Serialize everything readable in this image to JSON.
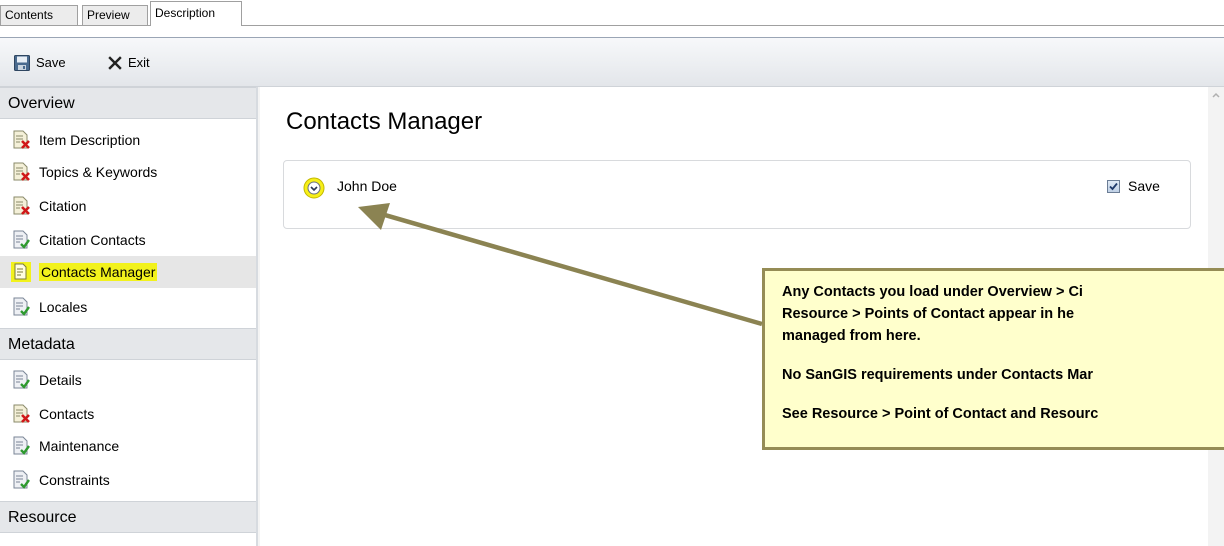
{
  "tabs": [
    {
      "label": "Contents",
      "active": false
    },
    {
      "label": "Preview",
      "active": false
    },
    {
      "label": "Description",
      "active": true
    }
  ],
  "toolbar": {
    "save_label": "Save",
    "exit_label": "Exit"
  },
  "sidebar": {
    "sections": [
      {
        "title": "Overview"
      },
      {
        "title": "Metadata"
      },
      {
        "title": "Resource"
      }
    ],
    "overview_items": [
      {
        "label": "Item Description",
        "status": "error"
      },
      {
        "label": "Topics & Keywords",
        "status": "error"
      },
      {
        "label": "Citation",
        "status": "error"
      },
      {
        "label": "Citation Contacts",
        "status": "ok"
      },
      {
        "label": "Contacts Manager",
        "status": "ok",
        "selected": true,
        "highlight_color": "#f2f21c"
      },
      {
        "label": "Locales",
        "status": "ok"
      }
    ],
    "metadata_items": [
      {
        "label": "Details",
        "status": "ok"
      },
      {
        "label": "Contacts",
        "status": "error"
      },
      {
        "label": "Maintenance",
        "status": "ok"
      },
      {
        "label": "Constraints",
        "status": "ok"
      }
    ]
  },
  "main": {
    "title": "Contacts Manager",
    "contacts": [
      {
        "name": "John Doe",
        "save_label": "Save",
        "save_checked": true
      }
    ]
  },
  "callout": {
    "lines": [
      "Any Contacts you load under Overview > Ci",
      "Resource > Points of Contact appear in he",
      "managed from here.",
      "No SanGIS requirements under Contacts Mar",
      "See Resource > Point of Contact and Resourc"
    ],
    "border_color": "#958c55",
    "background_color": "#ffffcc",
    "arrow_color": "#8b8352"
  },
  "colors": {
    "status_error": "#d01818",
    "status_ok": "#2e9a2e",
    "highlight": "#f2f21c"
  }
}
